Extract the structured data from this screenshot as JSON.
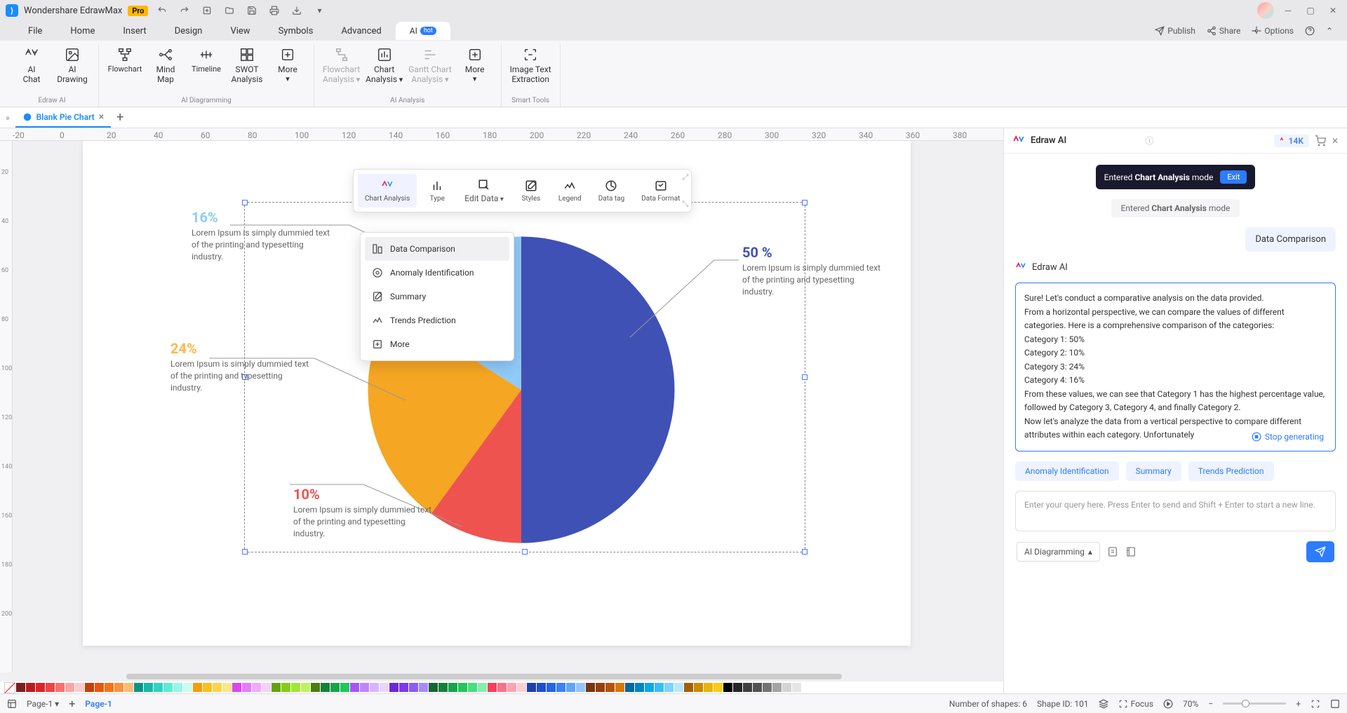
{
  "app": {
    "name": "Wondershare EdrawMax",
    "badge": "Pro"
  },
  "menus": [
    "File",
    "Home",
    "Insert",
    "Design",
    "View",
    "Symbols",
    "Advanced"
  ],
  "ai_menu": {
    "label": "AI",
    "hot": "hot"
  },
  "menu_right": {
    "publish": "Publish",
    "share": "Share",
    "options": "Options"
  },
  "ribbon": {
    "g1": {
      "label": "Edraw AI",
      "items": [
        {
          "l1": "AI",
          "l2": "Chat"
        },
        {
          "l1": "AI",
          "l2": "Drawing"
        }
      ]
    },
    "g2": {
      "label": "AI Diagramming",
      "items": [
        {
          "l1": "Flowchart"
        },
        {
          "l1": "Mind",
          "l2": "Map"
        },
        {
          "l1": "Timeline"
        },
        {
          "l1": "SWOT",
          "l2": "Analysis"
        },
        {
          "l1": "More"
        }
      ]
    },
    "g3": {
      "label": "AI Analysis",
      "items": [
        {
          "l1": "Flowchart",
          "l2": "Analysis",
          "disabled": true
        },
        {
          "l1": "Chart",
          "l2": "Analysis"
        },
        {
          "l1": "Gantt Chart",
          "l2": "Analysis",
          "disabled": true
        },
        {
          "l1": "More"
        }
      ]
    },
    "g4": {
      "label": "Smart Tools",
      "items": [
        {
          "l1": "Image Text",
          "l2": "Extraction"
        }
      ]
    }
  },
  "doc_tab": "Blank Pie Chart",
  "ruler_h": [
    "-20",
    "0",
    "20",
    "40",
    "60",
    "80",
    "100",
    "120",
    "140",
    "160",
    "180",
    "200",
    "220",
    "240",
    "260",
    "280",
    "300",
    "320",
    "340",
    "360",
    "380"
  ],
  "ruler_v": [
    "20",
    "40",
    "60",
    "80",
    "100",
    "120",
    "140",
    "160",
    "180",
    "200"
  ],
  "float_tb": [
    "Chart\nAnalysis",
    "Type",
    "Edit Data",
    "Styles",
    "Legend",
    "Data tag",
    "Data Format"
  ],
  "dropdown": [
    "Data Comparison",
    "Anomaly Identification",
    "Summary",
    "Trends Prediction",
    "More"
  ],
  "chart_data": {
    "type": "pie",
    "slices": [
      {
        "label": "50 %",
        "value": 50,
        "color": "#3f51b5",
        "desc": "Lorem Ipsum is simply dummied text of the printing and typesetting industry."
      },
      {
        "label": "10%",
        "value": 10,
        "color": "#ef5350",
        "desc": "Lorem Ipsum is simply dummied text of the printing and typesetting industry."
      },
      {
        "label": "24%",
        "value": 24,
        "color": "#f5a623",
        "desc": "Lorem Ipsum is simply dummied text of the printing and typesetting industry."
      },
      {
        "label": "16%",
        "value": 16,
        "color": "#90caf9",
        "desc": "Lorem Ipsum is simply dummied text of the printing and typesetting industry."
      }
    ]
  },
  "ai": {
    "title": "Edraw AI",
    "credits": "14K",
    "mode_pill_prefix": "Entered ",
    "mode_pill_bold": "Chart Analysis",
    "mode_pill_suffix": " mode",
    "exit": "Exit",
    "mode_note_prefix": "Entered ",
    "mode_note_bold": "Chart Analysis",
    "mode_note_suffix": " mode",
    "user_msg": "Data Comparison",
    "ai_msg": "Sure! Let's conduct a comparative analysis on the data provided.\nFrom a horizontal perspective, we can compare the values of different categories. Here is a comprehensive comparison of the categories:\nCategory 1: 50%\nCategory 2: 10%\nCategory 3: 24%\nCategory 4: 16%\nFrom these values, we can see that Category 1 has the highest percentage value, followed by Category 3, Category 4, and finally Category 2.\nNow let's analyze the data from a vertical perspective to compare different attributes within each category. Unfortunately",
    "stop": "Stop generating",
    "chips": [
      "Anomaly Identification",
      "Summary",
      "Trends Prediction"
    ],
    "input_placeholder": "Enter your query here. Press Enter to send and Shift + Enter to start a new line.",
    "mode_sel": "AI Diagramming"
  },
  "status": {
    "page_sel": "Page-1",
    "page_tab": "Page-1",
    "shapes": "Number of shapes: 6",
    "shape_id": "Shape ID: 101",
    "focus": "Focus",
    "zoom": "70%"
  },
  "colors": [
    "#7f1d1d",
    "#b91c1c",
    "#dc2626",
    "#ef4444",
    "#f87171",
    "#fca5a5",
    "#fecaca",
    "#c2410c",
    "#ea580c",
    "#f97316",
    "#fb923c",
    "#fdba74",
    "#0d9488",
    "#14b8a6",
    "#2dd4bf",
    "#5eead4",
    "#99f6e4",
    "#ccfbf1",
    "#f59e0b",
    "#fbbf24",
    "#fcd34d",
    "#fde68a",
    "#d946ef",
    "#e879f9",
    "#f0abfc",
    "#f5d0fe",
    "#65a30d",
    "#84cc16",
    "#a3e635",
    "#bef264",
    "#4d7c0f",
    "#15803d",
    "#16a34a",
    "#22c55e",
    "#a855f7",
    "#c084fc",
    "#d8b4fe",
    "#e9d5ff",
    "#6d28d9",
    "#7c3aed",
    "#8b5cf6",
    "#a78bfa",
    "#166534",
    "#15803d",
    "#16a34a",
    "#22c55e",
    "#4ade80",
    "#86efac",
    "#f43f5e",
    "#fb7185",
    "#fda4af",
    "#fecdd3",
    "#1e40af",
    "#1d4ed8",
    "#2563eb",
    "#3b82f6",
    "#60a5fa",
    "#93c5fd",
    "#78350f",
    "#92400e",
    "#b45309",
    "#d97706",
    "#0369a1",
    "#0284c7",
    "#0ea5e9",
    "#38bdf8",
    "#7dd3fc",
    "#bae6fd",
    "#a16207",
    "#ca8a04",
    "#eab308",
    "#facc15",
    "#000000",
    "#262626",
    "#404040",
    "#525252",
    "#737373",
    "#a3a3a3",
    "#d4d4d4",
    "#e5e5e5"
  ]
}
